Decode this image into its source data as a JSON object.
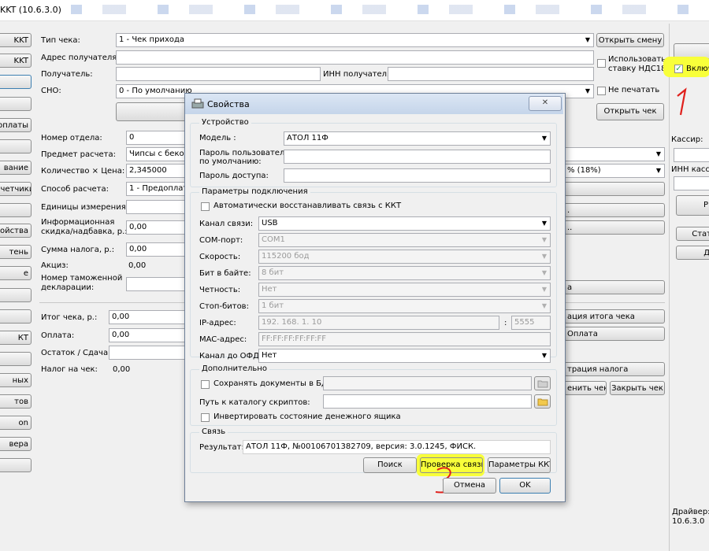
{
  "window": {
    "title": "KKT (10.6.3.0)"
  },
  "left_nav": [
    "KKT",
    "KKT",
    "",
    "",
    "оплаты",
    "",
    "вание",
    "счетчики",
    "",
    "ойства",
    "тень",
    "е",
    "",
    "",
    "КТ",
    "",
    "ных",
    "тов",
    "on",
    "вера",
    ""
  ],
  "form": {
    "receipt_type_label": "Тип чека:",
    "receipt_type_value": "1 - Чек прихода",
    "recipient_address_label": "Адрес получателя:",
    "recipient_label": "Получатель:",
    "recipient_inn_label": "ИНН получателя:",
    "sno_label": "СНО:",
    "sno_value": "0 - По умолчанию",
    "dept_label": "Номер отдела:",
    "dept_value": "0",
    "subject_label": "Предмет расчета:",
    "subject_value": "Чипсы с бекон",
    "qty_price_label": "Количество × Цена:",
    "qty_value": "2,345000",
    "payment_method_label": "Способ расчета:",
    "payment_method_value": "1 - Предоплата",
    "units_label": "Единицы измерения:",
    "info_discount_label_1": "Информационная",
    "info_discount_label_2": "скидка/надбавка, р.:",
    "info_discount_value": "0,00",
    "tax_sum_label": "Сумма налога, р.:",
    "tax_sum_value": "0,00",
    "excise_label": "Акциз:",
    "excise_value": "0,00",
    "customs_label_1": "Номер таможенной",
    "customs_label_2": "декларации:",
    "total_label": "Итог чека, р.:",
    "total_value": "0,00",
    "payment_label": "Оплата:",
    "payment_value": "0,00",
    "change_label": "Остаток / Сдача:",
    "tax_on_receipt_label": "Налог на чек:",
    "tax_on_receipt_value": "0,00"
  },
  "right_panel": {
    "open_shift": "Открыть смену",
    "use_vat18_1": "Использовать",
    "use_vat18_2": "ставку НДС18",
    "no_print": "Не печатать",
    "open_receipt": "Открыть чек",
    "vat_value": "% (18%)",
    "btn_partial_1": ".",
    "btn_partial_2": "..",
    "btn_partial_3": "а",
    "register_total": "ация итога чека",
    "payment_btn": "Оплата",
    "register_tax": "трация налога",
    "cancel_receipt": "енить чек",
    "close_receipt": "Закрыть чек"
  },
  "far_right": {
    "enable_checkbox": "Включ",
    "cashier_label": "Кассир:",
    "cashier_inn_label": "ИНН касс",
    "btn_r": "Р",
    "btn_stat": "Стат",
    "btn_d": "Д",
    "driver_label": "Драйвер:",
    "driver_version": "10.6.3.0"
  },
  "annotations": {
    "mark1": "1",
    "mark3": "3"
  },
  "dialog": {
    "title": "Свойства",
    "close_glyph": "✕",
    "device_group": "Устройство",
    "model_label": "Модель :",
    "model_value": "АТОЛ 11Ф",
    "user_password_label_1": "Пароль пользователя",
    "user_password_label_2": "по умолчанию:",
    "access_password_label": "Пароль доступа:",
    "conn_group": "Параметры подключения",
    "auto_reconnect": "Автоматически восстанавливать связь с ККТ",
    "channel_label": "Канал связи:",
    "channel_value": "USB",
    "com_label": "COM-порт:",
    "com_value": "COM1",
    "speed_label": "Скорость:",
    "speed_value": "115200 бод",
    "bits_label": "Бит в байте:",
    "bits_value": "8 бит",
    "parity_label": "Четность:",
    "parity_value": "Нет",
    "stopbits_label": "Стоп-битов:",
    "stopbits_value": "1 бит",
    "ip_label": "IP-адрес:",
    "ip_value": "192. 168. 1. 10",
    "port_sep": ":",
    "port_value": "5555",
    "mac_label": "MAC-адрес:",
    "mac_value": "FF:FF:FF:FF:FF:FF",
    "ofd_label": "Канал до ОФД:",
    "ofd_value": "Нет",
    "extra_group": "Дополнительно",
    "save_db": "Сохранять документы в БД",
    "scripts_path_label": "Путь к каталогу скриптов:",
    "invert_drawer": "Инвертировать состояние денежного ящика",
    "link_group": "Связь",
    "result_label": "Результат:",
    "result_value": "АТОЛ 11Ф, №00106701382709, версия: 3.0.1245, ФИСК.",
    "search_btn": "Поиск",
    "check_btn": "Проверка связи",
    "params_btn": "Параметры ККТ",
    "cancel_btn": "Отмена",
    "ok_btn": "OK"
  },
  "colors": {
    "highlight": "#f8ff3a",
    "annotation_red": "#e0201c",
    "title_blue": "#c5d5ea"
  }
}
